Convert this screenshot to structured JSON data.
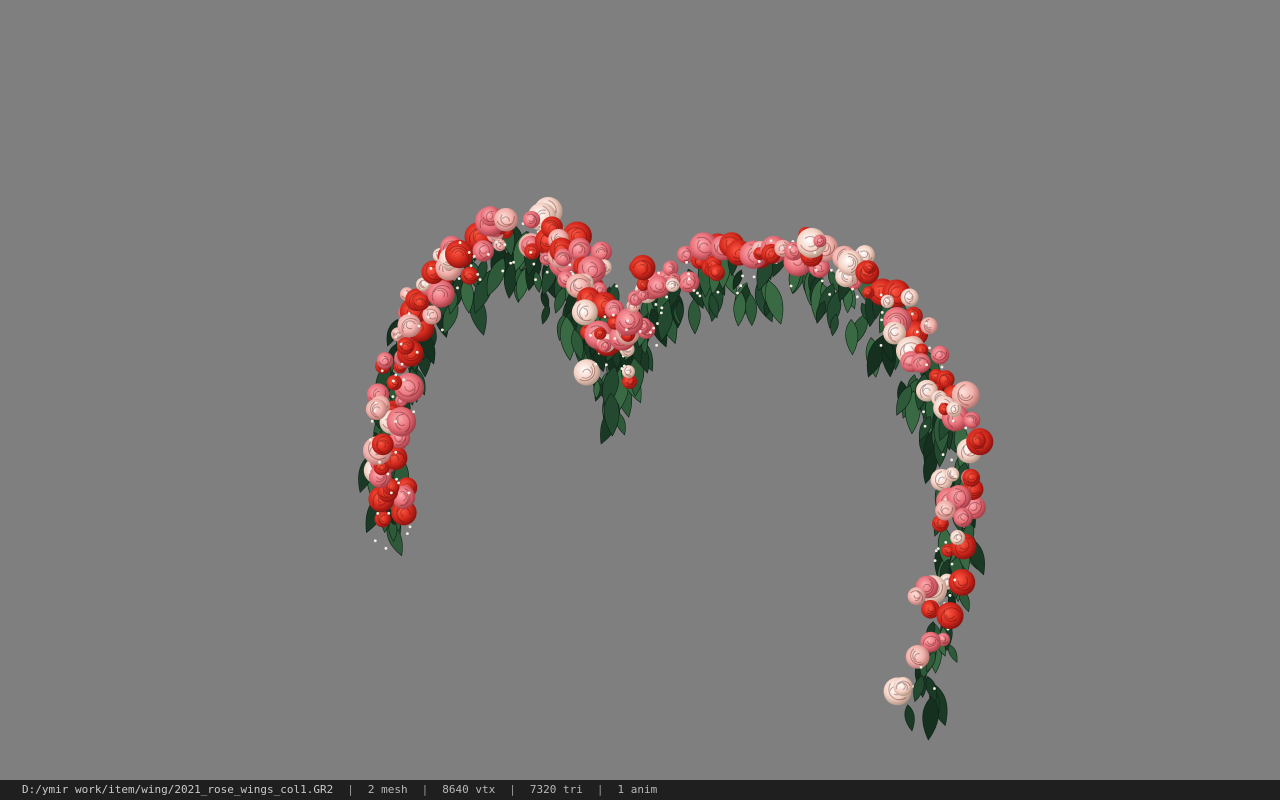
{
  "viewer": {
    "background_color": "#7f7f7f",
    "model": {
      "name": "rose-wings",
      "leaf_color": "#1f3f2a",
      "rose_colors": [
        "#d42a1e",
        "#e8707a",
        "#f2b0aa",
        "#f5d3c6"
      ]
    }
  },
  "status_bar": {
    "file_path": "D:/ymir work/item/wing/2021_rose_wings_col1.GR2",
    "separator": "|",
    "mesh_count": "2 mesh",
    "vertex_count": "8640 vtx",
    "triangle_count": "7320 tri",
    "anim_count": "1 anim"
  }
}
